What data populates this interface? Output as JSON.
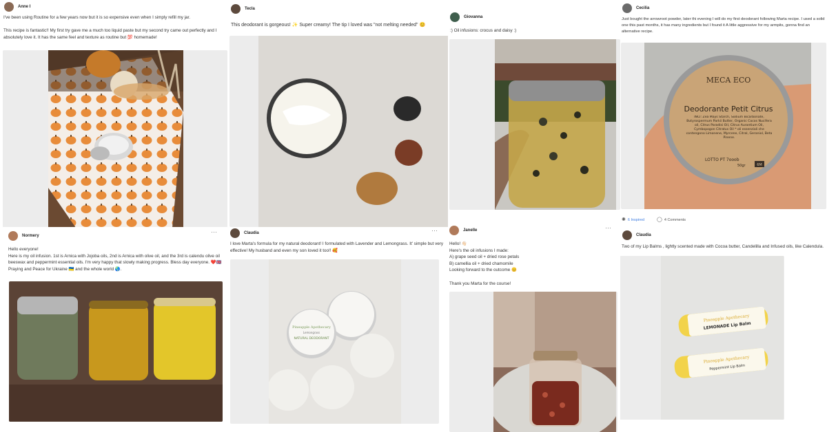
{
  "posts": [
    {
      "author": "Anne I",
      "text": [
        "I've been using Routine for a few years now but it is so expensive even when I simply refill my jar.",
        "",
        "This recipe is fantastic!! My first try gave me a much too liquid paste but my second try came out perfectly and I absolutely love it. It has the same feel and texture as routine but 💯 homemade!"
      ]
    },
    {
      "author": "Tecla",
      "text": [
        "This deodorant is gorgeous! ✨ Super creamy! The tip I loved was \"not melting needed\" 😊"
      ]
    },
    {
      "author": "Giovanna",
      "text": [
        ":) Oil infusions: crocus and daisy :)"
      ]
    },
    {
      "author": "Cecilia",
      "text": [
        "Just bought the arrowroot powder, later thi evening I will do my first deodorant following Marta recipe. I used a solid one this past months, it has many ingredients but I found it A little aggressive for my armpits, gonna find an alternative recipe."
      ],
      "label": {
        "brand": "MECA ECO",
        "title": "Deodorante Petit Citrus",
        "inci": "INCI: Zea Mays Starch, Sodium Bicarbonate, Butyrospermum Parkii Butter, Organic Cocos Nucifera oil, Citrus Paradisi Oil, Citrus Aurantium Oil, Cymbopogon Citratus Oil * oli essenziali che contengono Limonene, Myrcene, Citral, Geraniol, Beta Pinene.",
        "lot": "LOTTO PT 7ooob",
        "weight": "50gr",
        "pao": "6M"
      }
    },
    {
      "author": "Normery",
      "text": [
        "Hello everyone!",
        "Here is my oil infusion. 1st is Arnica with Jojoba oils, 2nd is Arnica with olive oil, and the 3rd is calendu olive oil beeswax and peppermint essential oils. I'm very happy that slowly making progress. Bless day everyone. ❤️🇬🇧 Praying and Peace for Ukraine 🇺🇦 and the whole world 🌏."
      ]
    },
    {
      "author": "Claudia",
      "text": [
        "I love Marta's formula for my natural deodorant! I formulated with Lavender and Lemongrass. It' simple but very effective! My husband and even my son loved it too!! 🥰"
      ],
      "label": {
        "line1": "Pineapple Apothecary",
        "line2": "Lemongrass",
        "line3": "NATURAL DEODORANT"
      }
    },
    {
      "author": "Janelle",
      "text": [
        "Hello! 👋🏻",
        "Here's the oil infusions I made:",
        "A) grape seed oil + dried rose petals",
        "B) camellia oil + dried chamomile",
        "Looking forward to the outcome 😊",
        "",
        "Thank you Marta for the course!"
      ]
    },
    {
      "author": "Claudia",
      "text": [
        "Two of my Lip Balms , lightly scented made with Cocoa butter, Candelilla and Infused oils, like Calendula."
      ],
      "label": {
        "brand": "Pineapple Apothecary",
        "product1": "LEMONADE Lip Balm",
        "product2": "Peppermint Lip Balm"
      }
    }
  ],
  "reactions": {
    "inspired": "6 Inspired",
    "comments": "4 Comments"
  },
  "colors": {
    "accent": "#3f7de0",
    "card_image_bg": "#ececec"
  }
}
